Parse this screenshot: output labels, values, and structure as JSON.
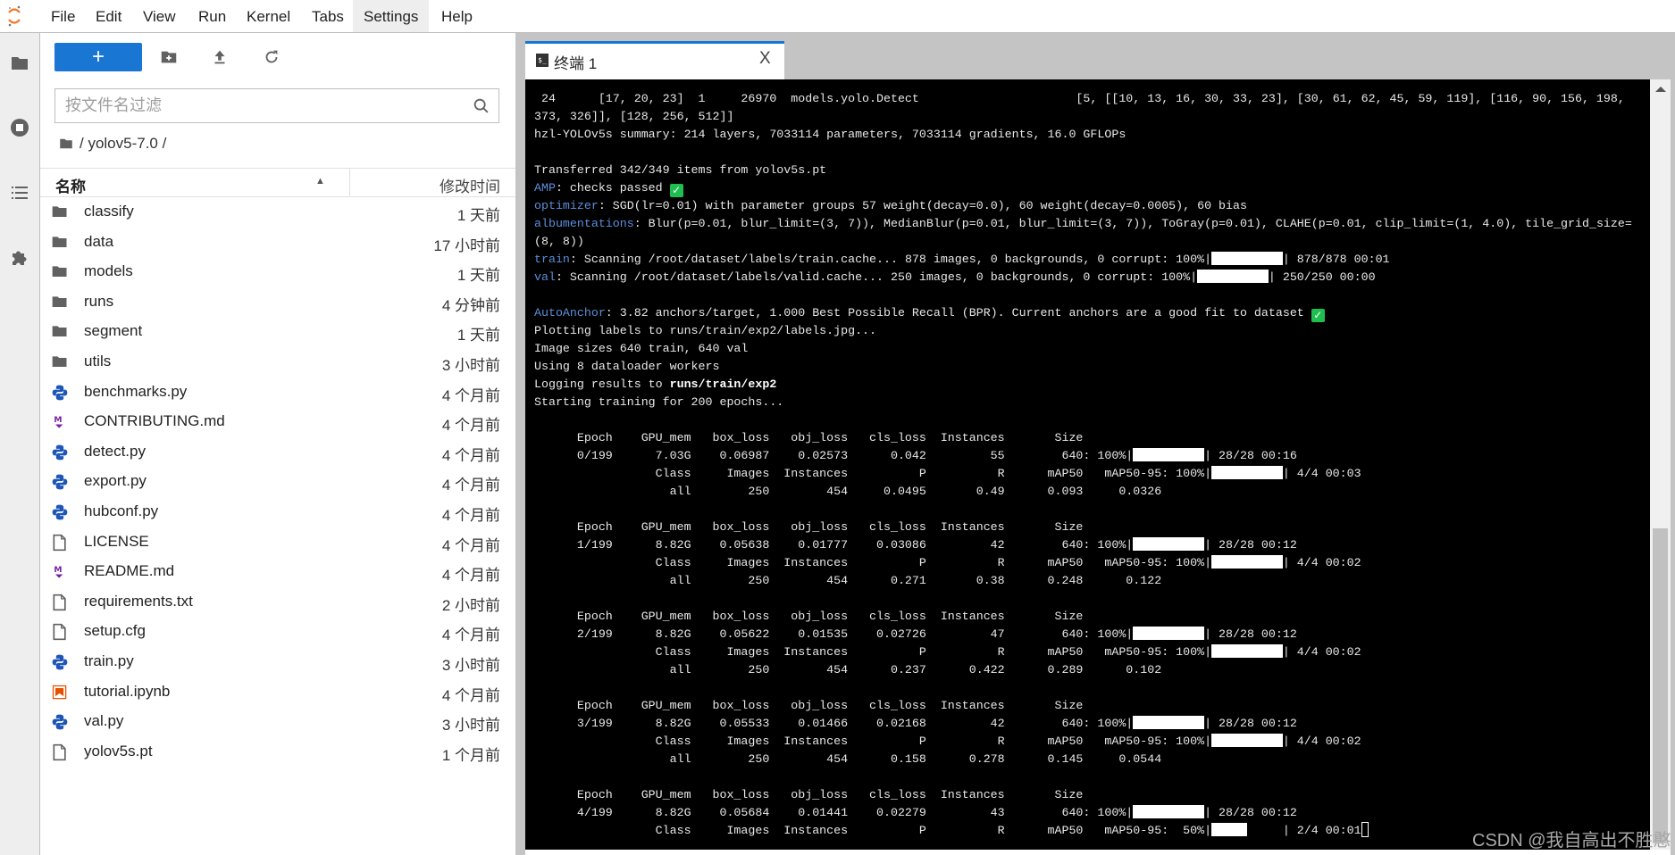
{
  "menubar": {
    "items": [
      "File",
      "Edit",
      "View",
      "Run",
      "Kernel",
      "Tabs",
      "Settings",
      "Help"
    ],
    "active": "Settings"
  },
  "sidebar_strip": {
    "icons": [
      "folder-icon",
      "running-stop-icon",
      "table-of-contents-icon",
      "extensions-puzzle-icon"
    ]
  },
  "file_browser": {
    "new_label": "+",
    "filter_placeholder": "按文件名过滤",
    "breadcrumb": "/ yolov5-7.0 /",
    "columns": {
      "name": "名称",
      "modified": "修改时间"
    },
    "files": [
      {
        "name": "classify",
        "modified": "1 天前",
        "type": "folder"
      },
      {
        "name": "data",
        "modified": "17 小时前",
        "type": "folder"
      },
      {
        "name": "models",
        "modified": "1 天前",
        "type": "folder"
      },
      {
        "name": "runs",
        "modified": "4 分钟前",
        "type": "folder"
      },
      {
        "name": "segment",
        "modified": "1 天前",
        "type": "folder"
      },
      {
        "name": "utils",
        "modified": "3 小时前",
        "type": "folder"
      },
      {
        "name": "benchmarks.py",
        "modified": "4 个月前",
        "type": "python"
      },
      {
        "name": "CONTRIBUTING.md",
        "modified": "4 个月前",
        "type": "markdown"
      },
      {
        "name": "detect.py",
        "modified": "4 个月前",
        "type": "python"
      },
      {
        "name": "export.py",
        "modified": "4 个月前",
        "type": "python"
      },
      {
        "name": "hubconf.py",
        "modified": "4 个月前",
        "type": "python"
      },
      {
        "name": "LICENSE",
        "modified": "4 个月前",
        "type": "file"
      },
      {
        "name": "README.md",
        "modified": "4 个月前",
        "type": "markdown"
      },
      {
        "name": "requirements.txt",
        "modified": "2 小时前",
        "type": "file"
      },
      {
        "name": "setup.cfg",
        "modified": "4 个月前",
        "type": "file"
      },
      {
        "name": "train.py",
        "modified": "3 小时前",
        "type": "python"
      },
      {
        "name": "tutorial.ipynb",
        "modified": "4 个月前",
        "type": "notebook"
      },
      {
        "name": "val.py",
        "modified": "3 小时前",
        "type": "python"
      },
      {
        "name": "yolov5s.pt",
        "modified": "1 个月前",
        "type": "file"
      }
    ]
  },
  "tab": {
    "label": "终端 1",
    "icon": "$_",
    "close": "X"
  },
  "colors": {
    "accent": "#1976d2",
    "terminal_prefix": "#5b8fdc",
    "check": "#1fbf4f"
  },
  "terminal": {
    "lines": [
      [
        " 24      [17, 20, 23]  1     26970  models.yolo.Detect                      [5, [[10, 13, 16, 30, 33, 23], [30, 61, 62, 45, 59, 119], [116, 90, 156, 198, "
      ],
      [
        "373, 326]], [128, 256, 512]]"
      ],
      [
        "hzl-YOLOv5s summary: 214 layers, 7033114 parameters, 7033114 gradients, 16.0 GFLOPs"
      ],
      [
        ""
      ],
      [
        "Transferred 342/349 items from yolov5s.pt"
      ],
      [
        {
          "t": "AMP",
          "s": "blue"
        },
        ": checks passed ",
        {
          "icon": "check"
        }
      ],
      [
        {
          "t": "optimizer",
          "s": "blue"
        },
        ": SGD(lr=0.01) with parameter groups 57 weight(decay=0.0), 60 weight(decay=0.0005), 60 bias"
      ],
      [
        {
          "t": "albumentations",
          "s": "blue"
        },
        ": Blur(p=0.01, blur_limit=(3, 7)), MedianBlur(p=0.01, blur_limit=(3, 7)), ToGray(p=0.01), CLAHE(p=0.01, clip_limit=(1, 4.0), tile_grid_size="
      ],
      [
        "(8, 8))"
      ],
      [
        {
          "t": "train",
          "s": "blue"
        },
        ": Scanning /root/dataset/labels/train.cache... 878 images, 0 backgrounds, 0 corrupt: 100%|",
        {
          "bar": 1.0
        },
        "| 878/878 00:01"
      ],
      [
        {
          "t": "val",
          "s": "blue"
        },
        ": Scanning /root/dataset/labels/valid.cache... 250 images, 0 backgrounds, 0 corrupt: 100%|",
        {
          "bar": 1.0
        },
        "| 250/250 00:00"
      ],
      [
        ""
      ],
      [
        {
          "t": "AutoAnchor",
          "s": "blue"
        },
        ": 3.82 anchors/target, 1.000 Best Possible Recall (BPR). Current anchors are a good fit to dataset ",
        {
          "icon": "check"
        }
      ],
      [
        "Plotting labels to runs/train/exp2/labels.jpg..."
      ],
      [
        "Image sizes 640 train, 640 val"
      ],
      [
        "Using 8 dataloader workers"
      ],
      [
        "Logging results to ",
        {
          "t": "runs/train/exp2",
          "s": "bold"
        }
      ],
      [
        "Starting training for 200 epochs..."
      ],
      [
        ""
      ]
    ],
    "train_headers": [
      "Epoch",
      "GPU_mem",
      "box_loss",
      "obj_loss",
      "cls_loss",
      "Instances",
      "Size"
    ],
    "val_headers": [
      "Class",
      "Images",
      "Instances",
      "P",
      "R",
      "mAP50",
      "mAP50-95"
    ],
    "epochs": [
      {
        "epoch": "0/199",
        "gpu_mem": "7.03G",
        "box_loss": "0.06987",
        "obj_loss": "0.02573",
        "cls_loss": "0.042",
        "instances": "55",
        "size": "640",
        "train_pct": 100,
        "train_progress": "28/28 00:16",
        "val_pct": 100,
        "val_progress": "4/4 00:03",
        "val": {
          "class": "all",
          "images": "250",
          "instances": "454",
          "P": "0.0495",
          "R": "0.49",
          "mAP50": "0.093",
          "mAP50_95": "0.0326"
        }
      },
      {
        "epoch": "1/199",
        "gpu_mem": "8.82G",
        "box_loss": "0.05638",
        "obj_loss": "0.01777",
        "cls_loss": "0.03086",
        "instances": "42",
        "size": "640",
        "train_pct": 100,
        "train_progress": "28/28 00:12",
        "val_pct": 100,
        "val_progress": "4/4 00:02",
        "val": {
          "class": "all",
          "images": "250",
          "instances": "454",
          "P": "0.271",
          "R": "0.38",
          "mAP50": "0.248",
          "mAP50_95": "0.122"
        }
      },
      {
        "epoch": "2/199",
        "gpu_mem": "8.82G",
        "box_loss": "0.05622",
        "obj_loss": "0.01535",
        "cls_loss": "0.02726",
        "instances": "47",
        "size": "640",
        "train_pct": 100,
        "train_progress": "28/28 00:12",
        "val_pct": 100,
        "val_progress": "4/4 00:02",
        "val": {
          "class": "all",
          "images": "250",
          "instances": "454",
          "P": "0.237",
          "R": "0.422",
          "mAP50": "0.289",
          "mAP50_95": "0.102"
        }
      },
      {
        "epoch": "3/199",
        "gpu_mem": "8.82G",
        "box_loss": "0.05533",
        "obj_loss": "0.01466",
        "cls_loss": "0.02168",
        "instances": "42",
        "size": "640",
        "train_pct": 100,
        "train_progress": "28/28 00:12",
        "val_pct": 100,
        "val_progress": "4/4 00:02",
        "val": {
          "class": "all",
          "images": "250",
          "instances": "454",
          "P": "0.158",
          "R": "0.278",
          "mAP50": "0.145",
          "mAP50_95": "0.0544"
        }
      },
      {
        "epoch": "4/199",
        "gpu_mem": "8.82G",
        "box_loss": "0.05684",
        "obj_loss": "0.01441",
        "cls_loss": "0.02279",
        "instances": "43",
        "size": "640",
        "train_pct": 100,
        "train_progress": "28/28 00:12",
        "val_pct": 50,
        "val_progress": "2/4 00:01",
        "val": null
      }
    ]
  },
  "watermark": "CSDN @我自高出不胜憨"
}
